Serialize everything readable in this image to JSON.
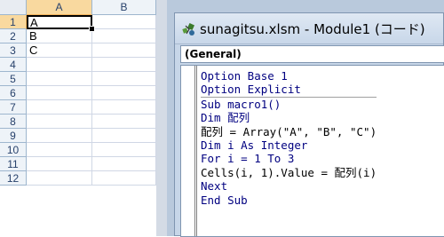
{
  "spreadsheet": {
    "columns": [
      "A",
      "B"
    ],
    "selected_column": "A",
    "rows": [
      "1",
      "2",
      "3",
      "4",
      "5",
      "6",
      "7",
      "8",
      "9",
      "10",
      "11",
      "12"
    ],
    "selected_row": "1",
    "cells_A": [
      "A",
      "B",
      "C",
      "",
      "",
      "",
      "",
      "",
      "",
      "",
      "",
      ""
    ],
    "cells_B": [
      "",
      "",
      "",
      "",
      "",
      "",
      "",
      "",
      "",
      "",
      "",
      ""
    ],
    "active_cell": "A1"
  },
  "vbe": {
    "window_title": "sunagitsu.xlsm - Module1 (コード)",
    "procedure_dropdown": "(General)",
    "code_lines": [
      "Option Base 1",
      "Option Explicit",
      "Sub macro1()",
      "Dim 配列",
      "配列 = Array(\"A\", \"B\", \"C\")",
      "Dim i As Integer",
      "For i = 1 To 3",
      "Cells(i, 1).Value = 配列(i)",
      "Next",
      "End Sub"
    ]
  },
  "colors": {
    "keyword": "#000080",
    "selection_header": "#f9d99f",
    "header_bg": "#eef3f8",
    "grid_line": "#d0d7e5",
    "window_bg": "#c7d6e8"
  },
  "icons": {
    "title_icon": "vba-module-icon"
  }
}
